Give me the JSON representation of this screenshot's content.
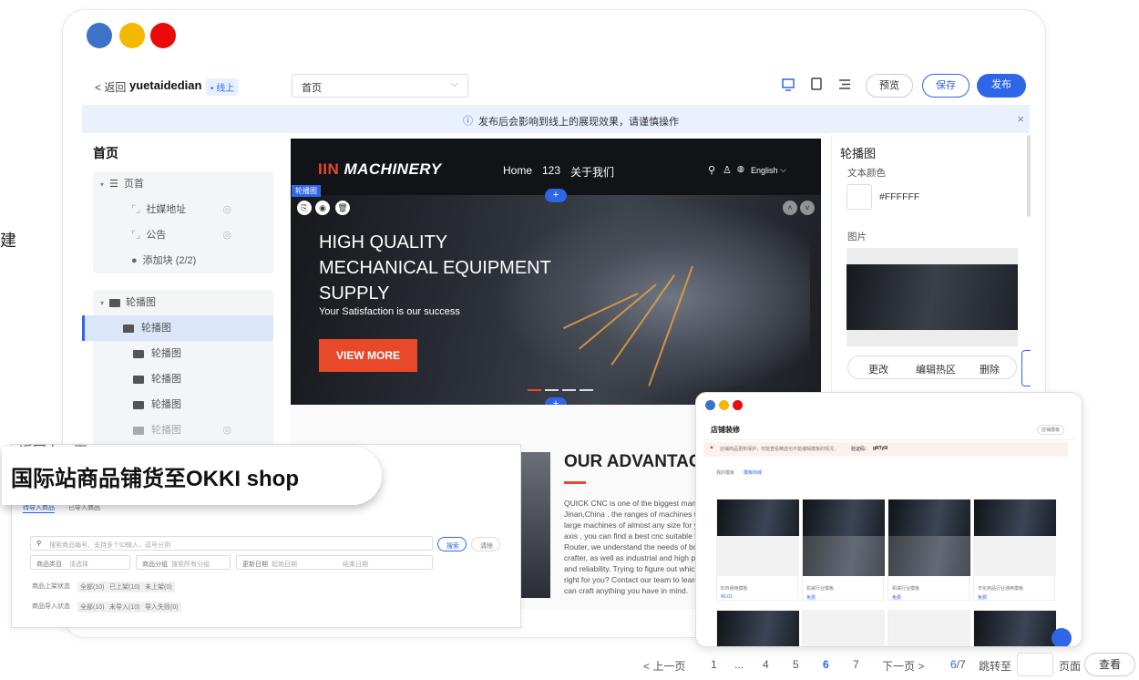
{
  "side_char": "建",
  "window_dots": [
    "#3d72c8",
    "#f5b800",
    "#ea0a0a"
  ],
  "toolbar": {
    "back": "< 返回",
    "store": "yuetaidedian",
    "online": "• 线上",
    "page_select": "首页",
    "preview": "预览",
    "save": "保存",
    "publish": "发布"
  },
  "notice": {
    "text": "发布后会影响到线上的展现效果，请谨慎操作",
    "close": "×"
  },
  "left_panel": {
    "title": "首页",
    "header_group": "页首",
    "header_items": [
      "社媒地址",
      "公告"
    ],
    "add_block": "添加块 (2/2)",
    "carousel_group": "轮播图",
    "carousel_items": [
      "轮播图",
      "轮播图",
      "轮播图",
      "轮播图",
      "轮播图"
    ]
  },
  "preview_site": {
    "logo_mark": "IIN",
    "logo_text": "MACHINERY",
    "nav": [
      "Home",
      "123",
      "关于我们"
    ],
    "lang": "English",
    "tag": "轮播图",
    "hero_lines": [
      "HIGH QUALITY",
      "MECHANICAL EQUIPMENT",
      "SUPPLY"
    ],
    "hero_sub": "Your Satisfaction is our success",
    "cta": "VIEW MORE",
    "adv_title": "OUR ADVANTAG",
    "adv_text": [
      "QUICK CNC is one of the biggest manuf",
      "Jinan,China . the ranges of machines we",
      "large machines of almost any size for yo",
      "axis , you can find a best cnc suitable fo",
      "Router, we understand the needs of bo",
      "crafter, as well as industrial and high pr",
      "and reliability. Trying to figure out whicl",
      "right for you? Contact our team to learr",
      "can craft anything you have in mind."
    ]
  },
  "right_panel": {
    "title": "轮播图",
    "text_color_label": "文本颜色",
    "text_color_value": "#FFFFFF",
    "image_label": "图片",
    "change": "更改",
    "edit_hotspot": "编辑热区",
    "delete": "删除"
  },
  "okki": {
    "back": "< 返回上一页",
    "title": "国际站商品铺货至OKKI shop",
    "tabs": [
      "待导入商品",
      "已导入商品"
    ],
    "search_placeholder": "搜索商品编号、支持多个ID输入，逗号分割",
    "search_btn": "搜索",
    "clear_btn": "清除",
    "category_label": "商品类目",
    "category_value": "请选择",
    "group_label": "商品分组",
    "group_value": "搜索所有分组",
    "date_label": "更新日期",
    "date_start": "起始日期",
    "date_end": "结束日期",
    "status_label": "商品上架状态",
    "status_opts": [
      "全部(10)",
      "已上架(10)",
      "未上架(0)"
    ],
    "import_label": "商品导入状态",
    "import_opts": [
      "全部(10)",
      "未导入(10)",
      "导入失败(0)"
    ]
  },
  "store_deco": {
    "title": "店铺装修",
    "btn": "店铺模板",
    "warn": "店铺商品更新保护，仅能查看精选也不能编辑模板的情况，",
    "code_label": "验证码：",
    "code": "gRTy5l",
    "tabs": [
      "我的模板",
      "模板商城"
    ],
    "templates": [
      {
        "name": "B2B通用模板",
        "price": "¥0.01"
      },
      {
        "name": "机械行业模板",
        "price": "免费"
      },
      {
        "name": "机械行业模板",
        "price": "免费"
      },
      {
        "name": "日化用品行业通用模板",
        "price": "免费"
      }
    ]
  },
  "pagination": {
    "prev": "< 上一页",
    "pages": [
      "1",
      "...",
      "4",
      "5",
      "6",
      "7"
    ],
    "current": "6",
    "next": "下一页 >",
    "status": "6/7",
    "goto": "跳转至",
    "page_unit": "页面",
    "go_btn": "查看"
  }
}
